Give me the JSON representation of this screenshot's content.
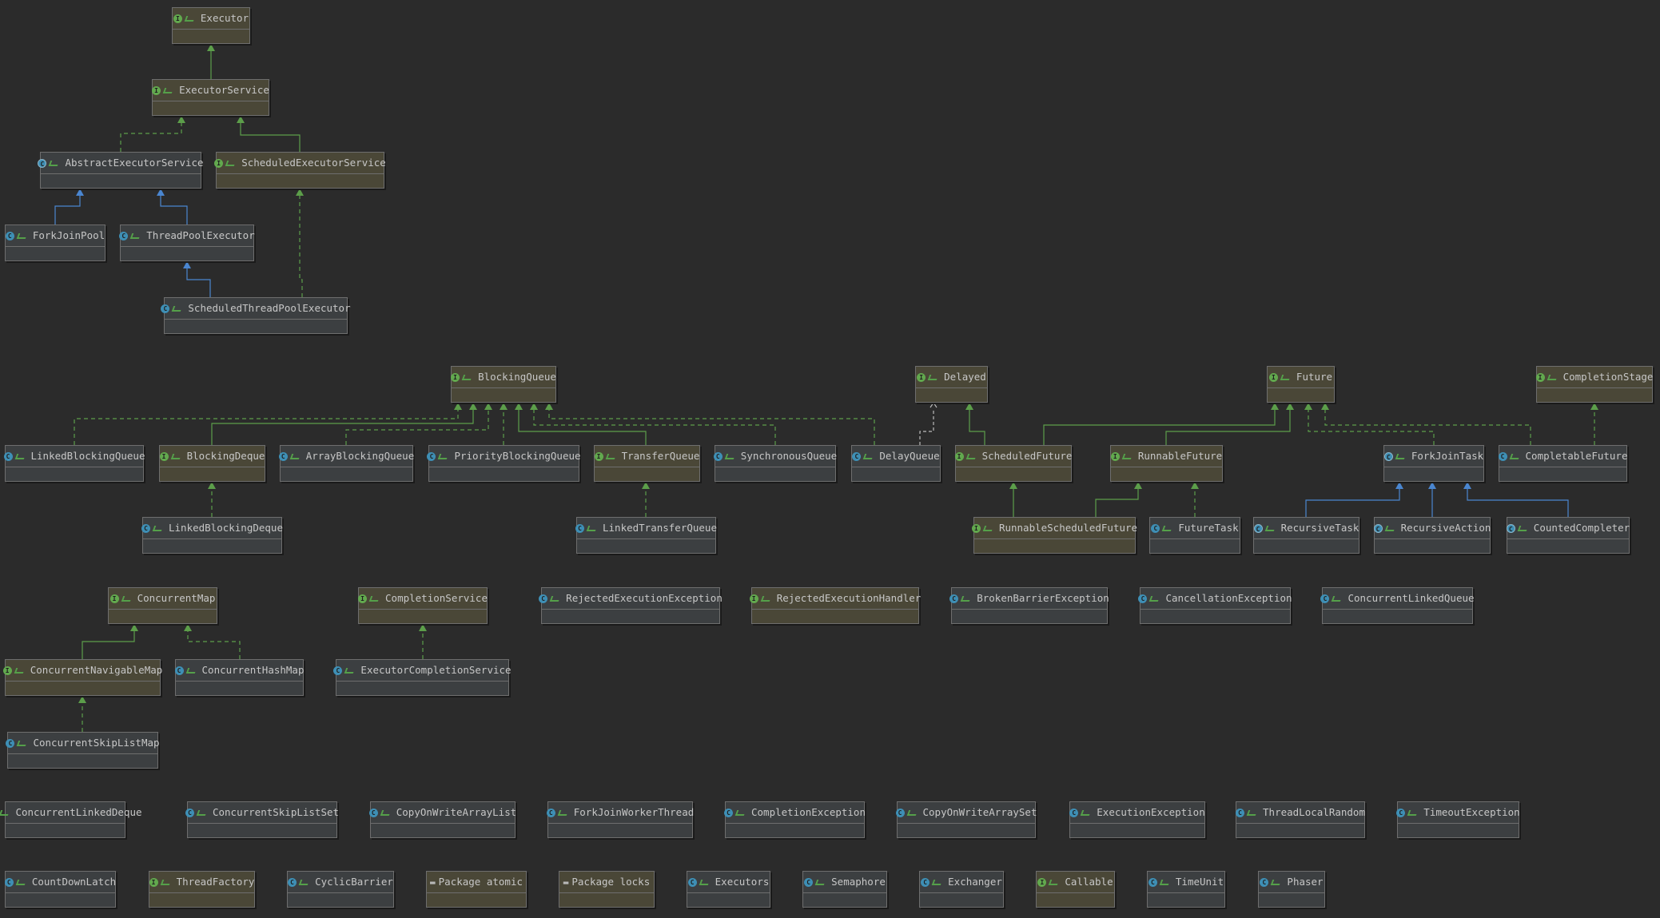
{
  "colors": {
    "background": "#2b2b2b",
    "interface_fill": "#4a4737",
    "class_fill": "#3c3f41",
    "implements_edge": "#5c9e4a",
    "extends_interface_edge": "#5c9e4a",
    "extends_class_edge": "#4a86d0",
    "dependency_edge": "#bbbbbb"
  },
  "nodes": [
    {
      "id": "Executor",
      "label": "Executor",
      "kind": "interface",
      "icon": "interface-icon"
    },
    {
      "id": "ExecutorService",
      "label": "ExecutorService",
      "kind": "interface",
      "icon": "interface-icon"
    },
    {
      "id": "AbstractExecutorService",
      "label": "AbstractExecutorService",
      "kind": "abstract",
      "icon": "abstract-class-icon"
    },
    {
      "id": "ScheduledExecutorService",
      "label": "ScheduledExecutorService",
      "kind": "interface",
      "icon": "interface-icon"
    },
    {
      "id": "ForkJoinPool",
      "label": "ForkJoinPool",
      "kind": "class",
      "icon": "class-icon"
    },
    {
      "id": "ThreadPoolExecutor",
      "label": "ThreadPoolExecutor",
      "kind": "class",
      "icon": "class-icon"
    },
    {
      "id": "ScheduledThreadPoolExecutor",
      "label": "ScheduledThreadPoolExecutor",
      "kind": "class",
      "icon": "class-icon"
    },
    {
      "id": "BlockingQueue",
      "label": "BlockingQueue",
      "kind": "interface",
      "icon": "interface-icon"
    },
    {
      "id": "Delayed",
      "label": "Delayed",
      "kind": "interface",
      "icon": "interface-icon"
    },
    {
      "id": "Future",
      "label": "Future",
      "kind": "interface",
      "icon": "interface-icon"
    },
    {
      "id": "CompletionStage",
      "label": "CompletionStage",
      "kind": "interface",
      "icon": "interface-icon"
    },
    {
      "id": "LinkedBlockingQueue",
      "label": "LinkedBlockingQueue",
      "kind": "class",
      "icon": "class-icon"
    },
    {
      "id": "BlockingDeque",
      "label": "BlockingDeque",
      "kind": "interface",
      "icon": "interface-icon"
    },
    {
      "id": "ArrayBlockingQueue",
      "label": "ArrayBlockingQueue",
      "kind": "class",
      "icon": "class-icon"
    },
    {
      "id": "PriorityBlockingQueue",
      "label": "PriorityBlockingQueue",
      "kind": "class",
      "icon": "class-icon"
    },
    {
      "id": "TransferQueue",
      "label": "TransferQueue",
      "kind": "interface",
      "icon": "interface-icon"
    },
    {
      "id": "SynchronousQueue",
      "label": "SynchronousQueue",
      "kind": "class",
      "icon": "class-icon"
    },
    {
      "id": "DelayQueue",
      "label": "DelayQueue",
      "kind": "class",
      "icon": "class-icon"
    },
    {
      "id": "ScheduledFuture",
      "label": "ScheduledFuture",
      "kind": "interface",
      "icon": "interface-icon"
    },
    {
      "id": "RunnableFuture",
      "label": "RunnableFuture",
      "kind": "interface",
      "icon": "interface-icon"
    },
    {
      "id": "ForkJoinTask",
      "label": "ForkJoinTask",
      "kind": "abstract",
      "icon": "abstract-class-icon"
    },
    {
      "id": "CompletableFuture",
      "label": "CompletableFuture",
      "kind": "class",
      "icon": "class-icon"
    },
    {
      "id": "LinkedBlockingDeque",
      "label": "LinkedBlockingDeque",
      "kind": "class",
      "icon": "class-icon"
    },
    {
      "id": "LinkedTransferQueue",
      "label": "LinkedTransferQueue",
      "kind": "class",
      "icon": "class-icon"
    },
    {
      "id": "RunnableScheduledFuture",
      "label": "RunnableScheduledFuture",
      "kind": "interface",
      "icon": "interface-icon"
    },
    {
      "id": "FutureTask",
      "label": "FutureTask",
      "kind": "class",
      "icon": "class-icon"
    },
    {
      "id": "RecursiveTask",
      "label": "RecursiveTask",
      "kind": "abstract",
      "icon": "abstract-class-icon"
    },
    {
      "id": "RecursiveAction",
      "label": "RecursiveAction",
      "kind": "abstract",
      "icon": "abstract-class-icon"
    },
    {
      "id": "CountedCompleter",
      "label": "CountedCompleter",
      "kind": "abstract",
      "icon": "abstract-class-icon"
    },
    {
      "id": "ConcurrentMap",
      "label": "ConcurrentMap",
      "kind": "interface",
      "icon": "interface-icon"
    },
    {
      "id": "CompletionService",
      "label": "CompletionService",
      "kind": "interface",
      "icon": "interface-icon"
    },
    {
      "id": "RejectedExecutionException",
      "label": "RejectedExecutionException",
      "kind": "class",
      "icon": "class-icon"
    },
    {
      "id": "RejectedExecutionHandler",
      "label": "RejectedExecutionHandler",
      "kind": "interface",
      "icon": "interface-icon"
    },
    {
      "id": "BrokenBarrierException",
      "label": "BrokenBarrierException",
      "kind": "class",
      "icon": "class-icon"
    },
    {
      "id": "CancellationException",
      "label": "CancellationException",
      "kind": "class",
      "icon": "class-icon"
    },
    {
      "id": "ConcurrentLinkedQueue",
      "label": "ConcurrentLinkedQueue",
      "kind": "class",
      "icon": "class-icon"
    },
    {
      "id": "ConcurrentNavigableMap",
      "label": "ConcurrentNavigableMap",
      "kind": "interface",
      "icon": "interface-icon"
    },
    {
      "id": "ConcurrentHashMap",
      "label": "ConcurrentHashMap",
      "kind": "class",
      "icon": "class-icon"
    },
    {
      "id": "ExecutorCompletionService",
      "label": "ExecutorCompletionService",
      "kind": "class",
      "icon": "class-icon"
    },
    {
      "id": "ConcurrentSkipListMap",
      "label": "ConcurrentSkipListMap",
      "kind": "class",
      "icon": "class-icon"
    },
    {
      "id": "ConcurrentLinkedDeque",
      "label": "ConcurrentLinkedDeque",
      "kind": "class",
      "icon": "class-icon"
    },
    {
      "id": "ConcurrentSkipListSet",
      "label": "ConcurrentSkipListSet",
      "kind": "class",
      "icon": "class-icon"
    },
    {
      "id": "CopyOnWriteArrayList",
      "label": "CopyOnWriteArrayList",
      "kind": "class",
      "icon": "class-icon"
    },
    {
      "id": "ForkJoinWorkerThread",
      "label": "ForkJoinWorkerThread",
      "kind": "class",
      "icon": "class-icon"
    },
    {
      "id": "CompletionException",
      "label": "CompletionException",
      "kind": "class",
      "icon": "class-icon"
    },
    {
      "id": "CopyOnWriteArraySet",
      "label": "CopyOnWriteArraySet",
      "kind": "class",
      "icon": "class-icon"
    },
    {
      "id": "ExecutionException",
      "label": "ExecutionException",
      "kind": "class",
      "icon": "class-icon"
    },
    {
      "id": "ThreadLocalRandom",
      "label": "ThreadLocalRandom",
      "kind": "class",
      "icon": "class-icon"
    },
    {
      "id": "TimeoutException",
      "label": "TimeoutException",
      "kind": "class",
      "icon": "class-icon"
    },
    {
      "id": "CountDownLatch",
      "label": "CountDownLatch",
      "kind": "class",
      "icon": "class-icon"
    },
    {
      "id": "ThreadFactory",
      "label": "ThreadFactory",
      "kind": "interface",
      "icon": "interface-icon"
    },
    {
      "id": "CyclicBarrier",
      "label": "CyclicBarrier",
      "kind": "class",
      "icon": "class-icon"
    },
    {
      "id": "PackageAtomic",
      "label": "Package atomic",
      "kind": "package",
      "icon": "folder-icon"
    },
    {
      "id": "PackageLocks",
      "label": "Package locks",
      "kind": "package",
      "icon": "folder-icon"
    },
    {
      "id": "Executors",
      "label": "Executors",
      "kind": "class",
      "icon": "class-icon"
    },
    {
      "id": "Semaphore",
      "label": "Semaphore",
      "kind": "class",
      "icon": "class-icon"
    },
    {
      "id": "Exchanger",
      "label": "Exchanger",
      "kind": "class",
      "icon": "class-icon"
    },
    {
      "id": "Callable",
      "label": "Callable",
      "kind": "interface",
      "icon": "interface-icon"
    },
    {
      "id": "TimeUnit",
      "label": "TimeUnit",
      "kind": "class",
      "icon": "class-icon"
    },
    {
      "id": "Phaser",
      "label": "Phaser",
      "kind": "class",
      "icon": "class-icon"
    }
  ],
  "edges": [
    {
      "from": "ExecutorService",
      "to": "Executor",
      "type": "extends-interface"
    },
    {
      "from": "AbstractExecutorService",
      "to": "ExecutorService",
      "type": "implements"
    },
    {
      "from": "ScheduledExecutorService",
      "to": "ExecutorService",
      "type": "extends-interface"
    },
    {
      "from": "ForkJoinPool",
      "to": "AbstractExecutorService",
      "type": "extends-class"
    },
    {
      "from": "ThreadPoolExecutor",
      "to": "AbstractExecutorService",
      "type": "extends-class"
    },
    {
      "from": "ScheduledThreadPoolExecutor",
      "to": "ThreadPoolExecutor",
      "type": "extends-class"
    },
    {
      "from": "ScheduledThreadPoolExecutor",
      "to": "ScheduledExecutorService",
      "type": "implements"
    },
    {
      "from": "LinkedBlockingQueue",
      "to": "BlockingQueue",
      "type": "implements"
    },
    {
      "from": "BlockingDeque",
      "to": "BlockingQueue",
      "type": "extends-interface"
    },
    {
      "from": "ArrayBlockingQueue",
      "to": "BlockingQueue",
      "type": "implements"
    },
    {
      "from": "PriorityBlockingQueue",
      "to": "BlockingQueue",
      "type": "implements"
    },
    {
      "from": "TransferQueue",
      "to": "BlockingQueue",
      "type": "extends-interface"
    },
    {
      "from": "SynchronousQueue",
      "to": "BlockingQueue",
      "type": "implements"
    },
    {
      "from": "DelayQueue",
      "to": "BlockingQueue",
      "type": "implements"
    },
    {
      "from": "DelayQueue",
      "to": "Delayed",
      "type": "dependency"
    },
    {
      "from": "ScheduledFuture",
      "to": "Delayed",
      "type": "extends-interface"
    },
    {
      "from": "ScheduledFuture",
      "to": "Future",
      "type": "extends-interface"
    },
    {
      "from": "RunnableFuture",
      "to": "Future",
      "type": "extends-interface"
    },
    {
      "from": "ForkJoinTask",
      "to": "Future",
      "type": "implements"
    },
    {
      "from": "CompletableFuture",
      "to": "Future",
      "type": "implements"
    },
    {
      "from": "CompletableFuture",
      "to": "CompletionStage",
      "type": "implements"
    },
    {
      "from": "LinkedBlockingDeque",
      "to": "BlockingDeque",
      "type": "implements"
    },
    {
      "from": "LinkedTransferQueue",
      "to": "TransferQueue",
      "type": "implements"
    },
    {
      "from": "RunnableScheduledFuture",
      "to": "ScheduledFuture",
      "type": "extends-interface"
    },
    {
      "from": "RunnableScheduledFuture",
      "to": "RunnableFuture",
      "type": "extends-interface"
    },
    {
      "from": "FutureTask",
      "to": "RunnableFuture",
      "type": "implements"
    },
    {
      "from": "RecursiveTask",
      "to": "ForkJoinTask",
      "type": "extends-class"
    },
    {
      "from": "RecursiveAction",
      "to": "ForkJoinTask",
      "type": "extends-class"
    },
    {
      "from": "CountedCompleter",
      "to": "ForkJoinTask",
      "type": "extends-class"
    },
    {
      "from": "ConcurrentNavigableMap",
      "to": "ConcurrentMap",
      "type": "extends-interface"
    },
    {
      "from": "ConcurrentHashMap",
      "to": "ConcurrentMap",
      "type": "implements"
    },
    {
      "from": "ExecutorCompletionService",
      "to": "CompletionService",
      "type": "implements"
    },
    {
      "from": "ConcurrentSkipListMap",
      "to": "ConcurrentNavigableMap",
      "type": "implements"
    }
  ]
}
